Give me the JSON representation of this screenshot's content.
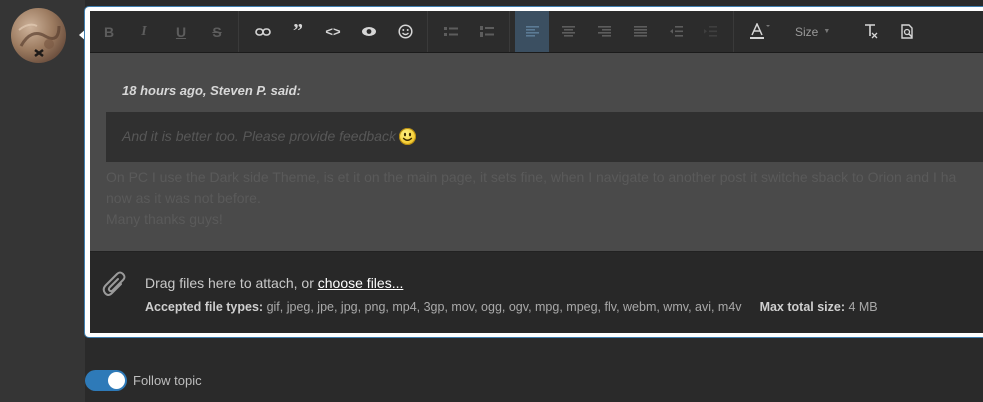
{
  "toolbar": {
    "bold": "B",
    "italic": "I",
    "underline": "U",
    "strike": "S",
    "size_label": "Size"
  },
  "quote": {
    "citation": "18 hours ago, Steven P. said:",
    "text": "And it is better too. Please provide feedback"
  },
  "post": {
    "line1": "On PC I use the Dark side Theme, is et it on the main page, it sets fine, when I navigate to another post it switche sback to Orion and I ha",
    "line2": "now as it was not before.",
    "line3": "Many thanks guys!"
  },
  "attachments": {
    "drag_text": "Drag files here to attach, or ",
    "choose_link": "choose files...",
    "types_label": "Accepted file types:",
    "types_value": " gif, jpeg, jpe, jpg, png, mp4, 3gp, mov, ogg, ogv, mpg, mpeg, flv, webm, wmv, avi, m4v",
    "max_label": "Max total size:",
    "max_value": " 4 MB"
  },
  "follow": {
    "label": "Follow topic",
    "enabled": true
  },
  "colors": {
    "accent": "#2e7ab8",
    "toolbar_bg": "#2c2c2c",
    "content_bg": "#4a4a4a"
  }
}
